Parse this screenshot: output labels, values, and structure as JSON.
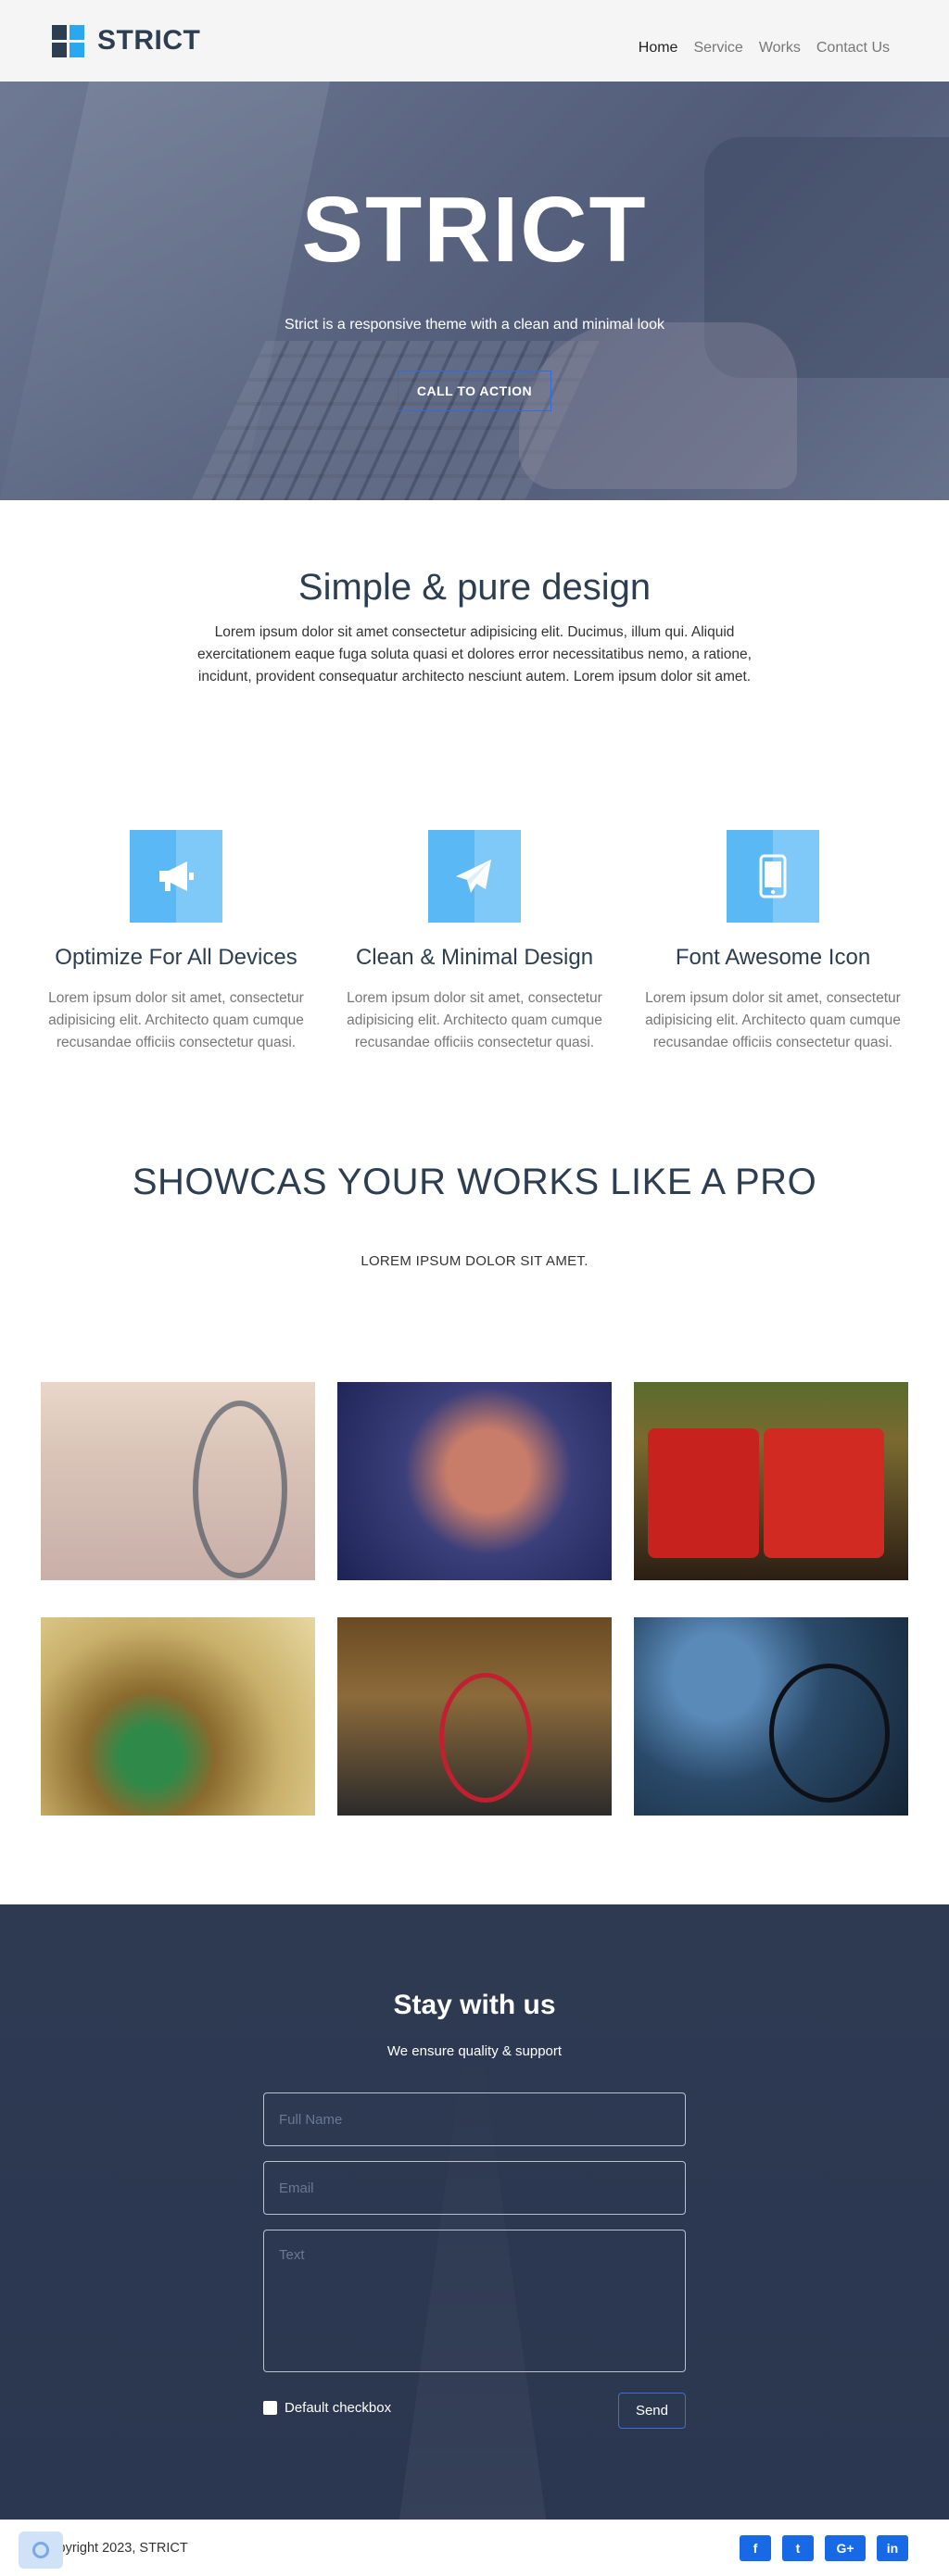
{
  "nav": {
    "brand": "STRICT",
    "items": [
      {
        "label": "Home",
        "active": true
      },
      {
        "label": "Service",
        "active": false
      },
      {
        "label": "Works",
        "active": false
      },
      {
        "label": "Contact Us",
        "active": false
      }
    ]
  },
  "hero": {
    "title": "STRICT",
    "subtitle": "Strict is a responsive theme with a clean and minimal look",
    "cta": "CALL TO ACTION"
  },
  "about": {
    "title": "Simple & pure design",
    "text": "Lorem ipsum dolor sit amet consectetur adipisicing elit. Ducimus, illum qui. Aliquid exercitationem eaque fuga soluta quasi et dolores error necessitatibus nemo, a ratione, incidunt, provident consequatur architecto nesciunt autem. Lorem ipsum dolor sit amet."
  },
  "features": [
    {
      "icon": "bullhorn-icon",
      "title": "Optimize For All Devices",
      "text": "Lorem ipsum dolor sit amet, consectetur adipisicing elit. Architecto quam cumque recusandae officiis consectetur quasi."
    },
    {
      "icon": "paper-plane-icon",
      "title": "Clean & Minimal Design",
      "text": "Lorem ipsum dolor sit amet, consectetur adipisicing elit. Architecto quam cumque recusandae officiis consectetur quasi."
    },
    {
      "icon": "mobile-icon",
      "title": "Font Awesome Icon",
      "text": "Lorem ipsum dolor sit amet, consectetur adipisicing elit. Architecto quam cumque recusandae officiis consectetur quasi."
    }
  ],
  "works": {
    "title": "SHOWCAS YOUR WORKS LIKE A PRO",
    "subtitle": "LOREM IPSUM DOLOR SIT AMET."
  },
  "contact": {
    "title": "Stay with us",
    "subtitle": "We ensure quality & support",
    "name_placeholder": "Full Name",
    "email_placeholder": "Email",
    "text_placeholder": "Text",
    "checkbox_label": "Default checkbox",
    "send_label": "Send"
  },
  "footer": {
    "copyright": "Copyright 2023, STRICT",
    "socials": [
      "f",
      "t",
      "G+",
      "in"
    ]
  },
  "colors": {
    "accent": "#29a8ef",
    "dark": "#2c3e50",
    "button_blue": "#1769e6",
    "contact_bg": "#2e3a52"
  }
}
